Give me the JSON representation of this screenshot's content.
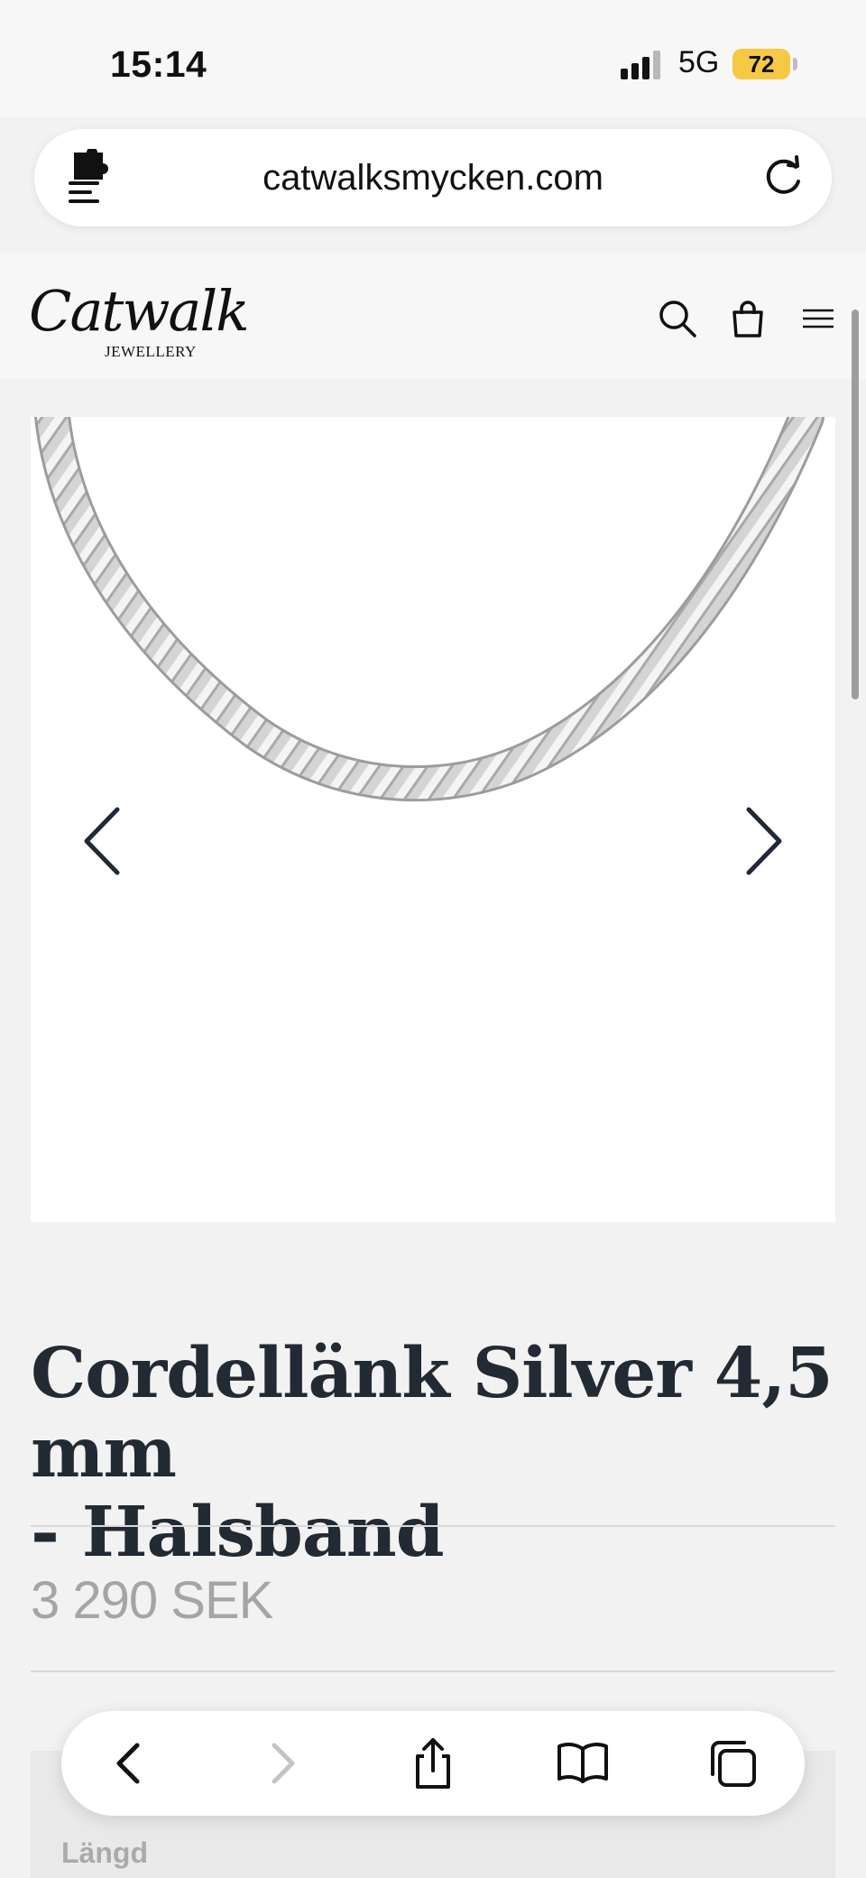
{
  "status_bar": {
    "time": "15:14",
    "network": "5G",
    "battery": "72"
  },
  "browser": {
    "url": "catwalksmycken.com"
  },
  "site": {
    "logo_script": "Catwalk",
    "logo_sub": "JEWELLERY"
  },
  "product": {
    "title_line1": "Cordellänk Silver 4,5 mm",
    "title_line2": "- Halsband",
    "price": "3 290 SEK",
    "option_label": "Längd"
  },
  "colors": {
    "battery": "#f6c945",
    "title": "#222a33",
    "price": "#a5a5a5"
  }
}
